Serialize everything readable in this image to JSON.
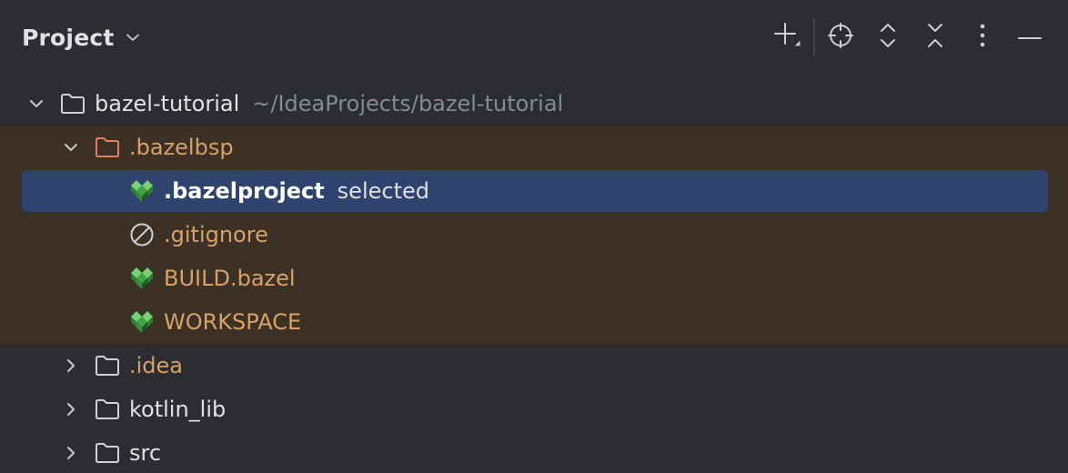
{
  "header": {
    "title": "Project",
    "toolbar": [
      {
        "name": "add-icon"
      },
      {
        "name": "locate-icon"
      },
      {
        "name": "expand-all-icon"
      },
      {
        "name": "collapse-all-icon"
      },
      {
        "name": "more-options-icon"
      },
      {
        "name": "hide-icon"
      }
    ]
  },
  "tree": {
    "root": {
      "label": "bazel-tutorial",
      "path": "~/IdeaProjects/bazel-tutorial",
      "expanded": true
    },
    "bazelbsp": {
      "label": ".bazelbsp",
      "expanded": true,
      "children": [
        {
          "label": ".bazelproject",
          "tag": "selected",
          "icon": "bazel-icon"
        },
        {
          "label": ".gitignore",
          "icon": "ignored-file-icon"
        },
        {
          "label": "BUILD.bazel",
          "icon": "bazel-icon"
        },
        {
          "label": "WORKSPACE",
          "icon": "bazel-icon"
        }
      ]
    },
    "folders": [
      {
        "label": ".idea",
        "excluded": true
      },
      {
        "label": "kotlin_lib",
        "excluded": false
      },
      {
        "label": "src",
        "excluded": false
      }
    ]
  },
  "colors": {
    "background": "#2b2d30",
    "excluded_row": "#3d3024",
    "selection": "#2e436e",
    "excluded_text": "#d6a16a",
    "path_hint": "#868a91"
  }
}
